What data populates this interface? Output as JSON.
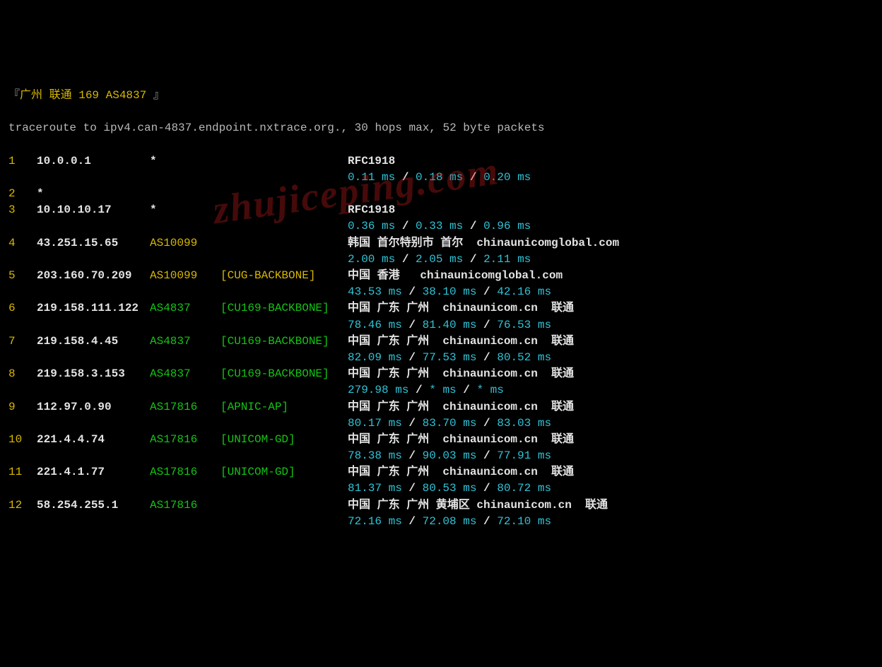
{
  "header": {
    "bracket_open": "『",
    "line": "广州 联通 169 AS4837 ",
    "bracket_close": "』"
  },
  "cmdline": "traceroute to ipv4.can-4837.endpoint.nxtrace.org., 30 hops max, 52 byte packets",
  "watermark": "zhujiceping.com",
  "hops": [
    {
      "hop": "1",
      "ip": "10.0.0.1",
      "asn": "*",
      "tag": "",
      "info": "RFC1918",
      "times": [
        "0.11 ms",
        "0.18 ms",
        "0.20 ms"
      ]
    },
    {
      "hop": "2",
      "ip": "*",
      "asn": "",
      "tag": "",
      "info": "",
      "times": null
    },
    {
      "hop": "3",
      "ip": "10.10.10.17",
      "asn": "*",
      "tag": "",
      "info": "RFC1918",
      "times": [
        "0.36 ms",
        "0.33 ms",
        "0.96 ms"
      ]
    },
    {
      "hop": "4",
      "ip": "43.251.15.65",
      "asn": "AS10099",
      "tag": "",
      "info": "韩国 首尔特别市 首尔  chinaunicomglobal.com",
      "times": [
        "2.00 ms",
        "2.05 ms",
        "2.11 ms"
      ]
    },
    {
      "hop": "5",
      "ip": "203.160.70.209",
      "asn": "AS10099",
      "tag": "[CUG-BACKBONE]",
      "info": "中国 香港   chinaunicomglobal.com",
      "times": [
        "43.53 ms",
        "38.10 ms",
        "42.16 ms"
      ]
    },
    {
      "hop": "6",
      "ip": "219.158.111.122",
      "asn": "AS4837",
      "tag": "[CU169-BACKBONE]",
      "info": "中国 广东 广州  chinaunicom.cn  联通",
      "times": [
        "78.46 ms",
        "81.40 ms",
        "76.53 ms"
      ]
    },
    {
      "hop": "7",
      "ip": "219.158.4.45",
      "asn": "AS4837",
      "tag": "[CU169-BACKBONE]",
      "info": "中国 广东 广州  chinaunicom.cn  联通",
      "times": [
        "82.09 ms",
        "77.53 ms",
        "80.52 ms"
      ]
    },
    {
      "hop": "8",
      "ip": "219.158.3.153",
      "asn": "AS4837",
      "tag": "[CU169-BACKBONE]",
      "info": "中国 广东 广州  chinaunicom.cn  联通",
      "times": [
        "279.98 ms",
        "* ms",
        "* ms"
      ]
    },
    {
      "hop": "9",
      "ip": "112.97.0.90",
      "asn": "AS17816",
      "tag": "[APNIC-AP]",
      "info": "中国 广东 广州  chinaunicom.cn  联通",
      "times": [
        "80.17 ms",
        "83.70 ms",
        "83.03 ms"
      ]
    },
    {
      "hop": "10",
      "ip": "221.4.4.74",
      "asn": "AS17816",
      "tag": "[UNICOM-GD]",
      "info": "中国 广东 广州  chinaunicom.cn  联通",
      "times": [
        "78.38 ms",
        "90.03 ms",
        "77.91 ms"
      ]
    },
    {
      "hop": "11",
      "ip": "221.4.1.77",
      "asn": "AS17816",
      "tag": "[UNICOM-GD]",
      "info": "中国 广东 广州  chinaunicom.cn  联通",
      "times": [
        "81.37 ms",
        "80.53 ms",
        "80.72 ms"
      ]
    },
    {
      "hop": "12",
      "ip": "58.254.255.1",
      "asn": "AS17816",
      "tag": "",
      "info": "中国 广东 广州 黄埔区 chinaunicom.cn  联通",
      "times": [
        "72.16 ms",
        "72.08 ms",
        "72.10 ms"
      ]
    }
  ]
}
